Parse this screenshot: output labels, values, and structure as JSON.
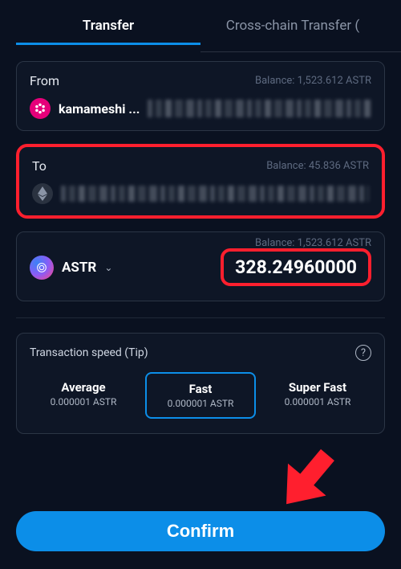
{
  "tabs": {
    "transfer": "Transfer",
    "crosschain": "Cross-chain Transfer ("
  },
  "from": {
    "label": "From",
    "balance": "Balance: 1,523.612 ASTR",
    "wallet_name": "kamameshi ..."
  },
  "to": {
    "label": "To",
    "balance": "Balance: 45.836 ASTR"
  },
  "token": {
    "symbol": "ASTR",
    "balance": "Balance: 1,523.612 ASTR",
    "amount": "328.24960000"
  },
  "speed": {
    "title": "Transaction speed (Tip)",
    "options": [
      {
        "name": "Average",
        "value": "0.000001 ASTR"
      },
      {
        "name": "Fast",
        "value": "0.000001 ASTR"
      },
      {
        "name": "Super Fast",
        "value": "0.000001 ASTR"
      }
    ]
  },
  "confirm": "Confirm"
}
